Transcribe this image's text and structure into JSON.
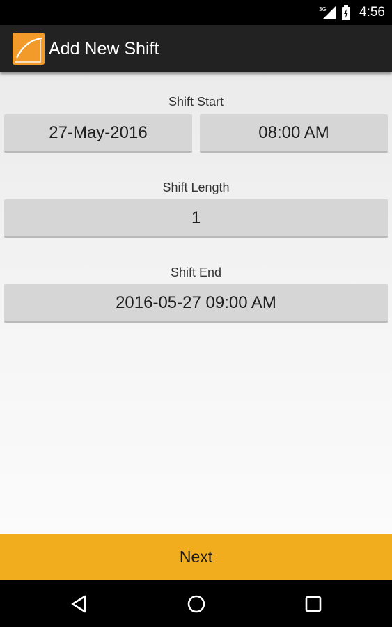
{
  "status_bar": {
    "network_label": "3G",
    "time": "4:56",
    "icons": [
      "network-3g-icon",
      "signal-icon",
      "battery-icon"
    ]
  },
  "action_bar": {
    "title": "Add New Shift",
    "logo_icon": "app-logo-icon",
    "colors": {
      "background": "#222222",
      "logo": "#f29a2a"
    }
  },
  "form": {
    "shift_start": {
      "label": "Shift Start",
      "date": "27-May-2016",
      "time": "08:00 AM"
    },
    "shift_length": {
      "label": "Shift Length",
      "value": "1"
    },
    "shift_end": {
      "label": "Shift End",
      "value": "2016-05-27 09:00 AM"
    }
  },
  "next_button": {
    "label": "Next",
    "color": "#f2ad1f"
  },
  "nav_bar": {
    "icons": [
      "back-icon",
      "home-icon",
      "recents-icon"
    ]
  }
}
